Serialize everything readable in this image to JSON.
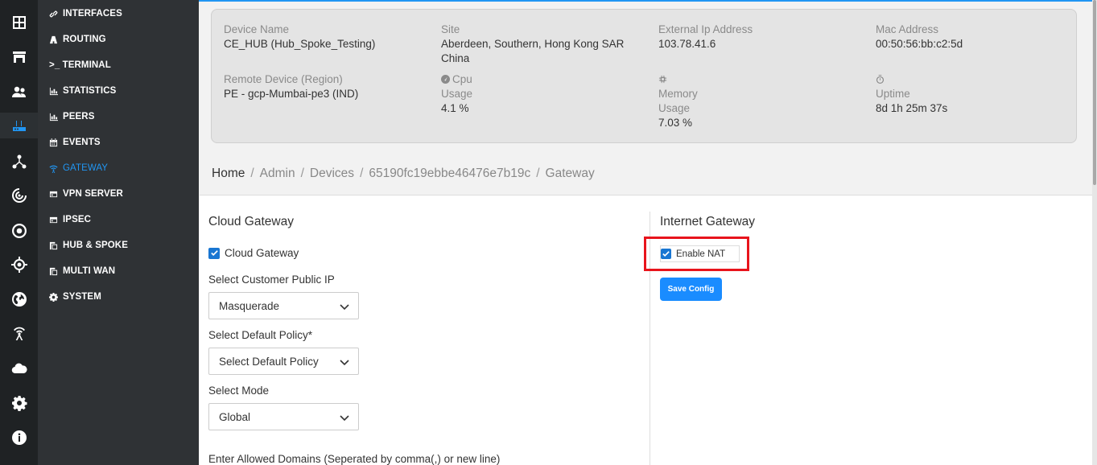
{
  "sidebar": {
    "items": [
      {
        "label": "INTERFACES",
        "icon": "link-icon"
      },
      {
        "label": "ROUTING",
        "icon": "road-icon"
      },
      {
        "label": ">_ TERMINAL",
        "icon": "terminal-icon"
      },
      {
        "label": "STATISTICS",
        "icon": "bar-chart-icon"
      },
      {
        "label": "PEERS",
        "icon": "bar-chart-icon"
      },
      {
        "label": "EVENTS",
        "icon": "calendar-icon"
      },
      {
        "label": "GATEWAY",
        "icon": "wifi-icon"
      },
      {
        "label": "VPN SERVER",
        "icon": "server-icon"
      },
      {
        "label": "IPSEC",
        "icon": "server-icon"
      },
      {
        "label": "HUB & SPOKE",
        "icon": "copy-icon"
      },
      {
        "label": "MULTI WAN",
        "icon": "copy-icon"
      },
      {
        "label": "SYSTEM",
        "icon": "gear-icon"
      }
    ],
    "active": "GATEWAY"
  },
  "rail": {
    "icons": [
      "dashboard-icon",
      "store-icon",
      "users-icon",
      "router-icon",
      "network-icon",
      "radar-icon",
      "target-icon",
      "crosshair-icon",
      "globe-icon",
      "antenna-icon",
      "cloud-icon",
      "settings-icon",
      "info-icon"
    ]
  },
  "device": {
    "name_label": "Device Name",
    "name_value": "CE_HUB (Hub_Spoke_Testing)",
    "site_label": "Site",
    "site_value_1": "Aberdeen, Southern, Hong Kong SAR",
    "site_value_2": "China",
    "ext_ip_label": "External Ip Address",
    "ext_ip_value": "103.78.41.6",
    "mac_label": "Mac Address",
    "mac_value": "00:50:56:bb:c2:5d",
    "remote_label": "Remote Device (Region)",
    "remote_value": "PE - gcp-Mumbai-pe3 (IND)",
    "cpu_label_1": "Cpu",
    "cpu_label_2": "Usage",
    "cpu_value": "4.1 %",
    "mem_label_1": "Memory",
    "mem_label_2": "Usage",
    "mem_value": "7.03 %",
    "uptime_label": "Uptime",
    "uptime_value": "8d 1h 25m 37s"
  },
  "breadcrumb": {
    "home": "Home",
    "admin": "Admin",
    "devices": "Devices",
    "device_id": "65190fc19ebbe46476e7b19c",
    "current": "Gateway",
    "separator": "/"
  },
  "cloud_gateway": {
    "title": "Cloud Gateway",
    "checkbox_label": "Cloud Gateway",
    "checked": true,
    "public_ip_label": "Select Customer Public IP",
    "public_ip_value": "Masquerade",
    "policy_label": "Select Default Policy*",
    "policy_value": "Select Default Policy",
    "mode_label": "Select Mode",
    "mode_value": "Global",
    "domains_label": "Enter Allowed Domains (Seperated by comma(,) or new line)"
  },
  "internet_gateway": {
    "title": "Internet Gateway",
    "nat_label": "Enable NAT",
    "nat_checked": true,
    "save_label": "Save Config"
  },
  "colors": {
    "accent": "#2196f3",
    "highlight": "#e8141c",
    "button": "#1a8cff"
  }
}
